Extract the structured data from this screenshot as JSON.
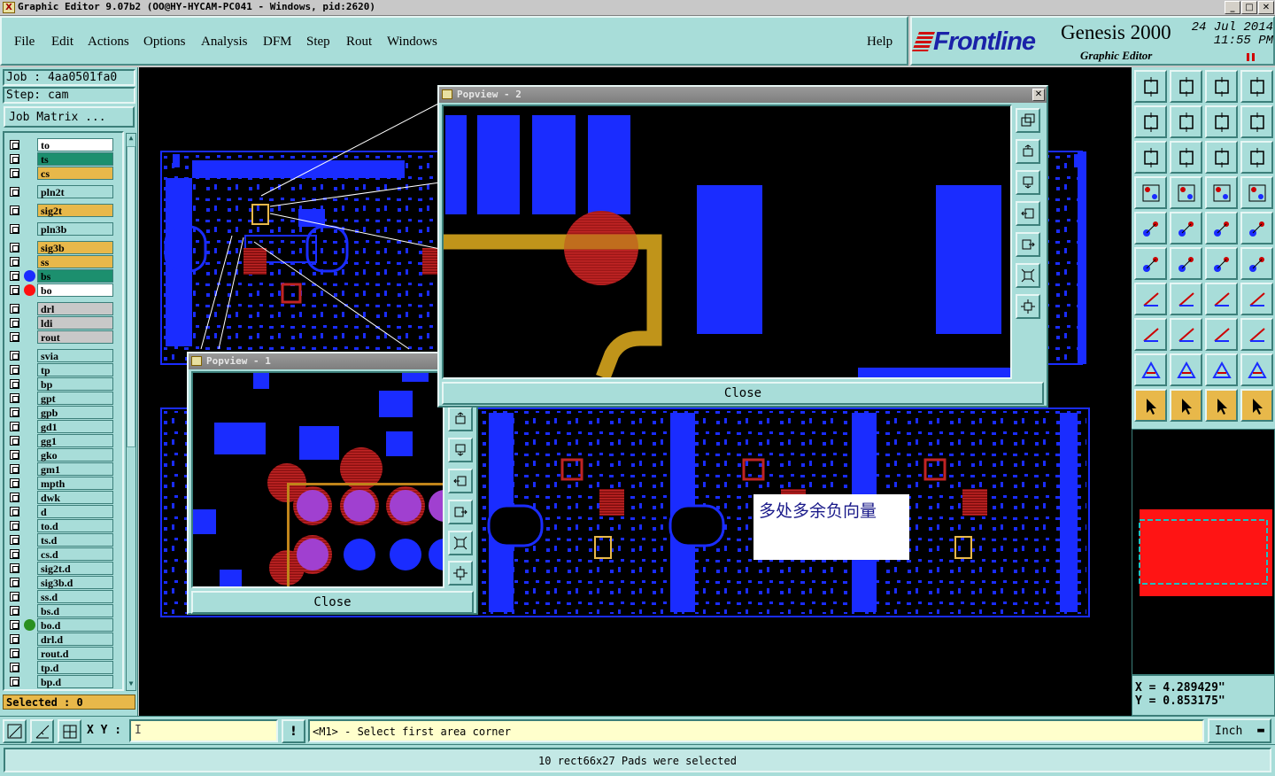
{
  "window": {
    "title": "Graphic Editor 9.07b2  (OO@HY-HYCAM-PC041 - Windows, pid:2620)",
    "min": "_",
    "max": "□",
    "close": "✕"
  },
  "menu": [
    "File",
    "Edit",
    "Actions",
    "Options",
    "Analysis",
    "DFM",
    "Step",
    "Rout",
    "Windows"
  ],
  "help": "Help",
  "brand": {
    "logo": "Frontline",
    "product": "Genesis 2000",
    "subtitle": "Graphic Editor",
    "date": "24 Jul 2014",
    "time": "11:55 PM"
  },
  "job": {
    "job": "Job : 4aa0501fa0",
    "step": "Step: cam",
    "matrix": "Job Matrix ..."
  },
  "layers": [
    {
      "name": "to",
      "bg": "#ffffff",
      "dot": ""
    },
    {
      "name": "ts",
      "bg": "#1c8f6e",
      "dot": ""
    },
    {
      "name": "cs",
      "bg": "#e8b84a",
      "dot": ""
    },
    {
      "name": "pln2t",
      "bg": "#a8ddd9",
      "dot": ""
    },
    {
      "name": "sig2t",
      "bg": "#e8b84a",
      "dot": ""
    },
    {
      "name": "pln3b",
      "bg": "#a8ddd9",
      "dot": ""
    },
    {
      "name": "sig3b",
      "bg": "#e8b84a",
      "dot": ""
    },
    {
      "name": "ss",
      "bg": "#e8b84a",
      "dot": ""
    },
    {
      "name": "bs",
      "bg": "#1c8f6e",
      "dot": "#1a2cff"
    },
    {
      "name": "bo",
      "bg": "#ffffff",
      "dot": "#ff1010"
    },
    {
      "name": "drl",
      "bg": "#c8c8c8",
      "dot": ""
    },
    {
      "name": "ldi",
      "bg": "#c8c8c8",
      "dot": ""
    },
    {
      "name": "rout",
      "bg": "#c8c8c8",
      "dot": ""
    },
    {
      "name": "svia",
      "bg": "#a8ddd9",
      "dot": ""
    },
    {
      "name": "tp",
      "bg": "#a8ddd9",
      "dot": ""
    },
    {
      "name": "bp",
      "bg": "#a8ddd9",
      "dot": ""
    },
    {
      "name": "gpt",
      "bg": "#a8ddd9",
      "dot": ""
    },
    {
      "name": "gpb",
      "bg": "#a8ddd9",
      "dot": ""
    },
    {
      "name": "gd1",
      "bg": "#a8ddd9",
      "dot": ""
    },
    {
      "name": "gg1",
      "bg": "#a8ddd9",
      "dot": ""
    },
    {
      "name": "gko",
      "bg": "#a8ddd9",
      "dot": ""
    },
    {
      "name": "gm1",
      "bg": "#a8ddd9",
      "dot": ""
    },
    {
      "name": "mpth",
      "bg": "#a8ddd9",
      "dot": ""
    },
    {
      "name": "dwk",
      "bg": "#a8ddd9",
      "dot": ""
    },
    {
      "name": "d",
      "bg": "#a8ddd9",
      "dot": ""
    },
    {
      "name": "to.d",
      "bg": "#a8ddd9",
      "dot": ""
    },
    {
      "name": "ts.d",
      "bg": "#a8ddd9",
      "dot": ""
    },
    {
      "name": "cs.d",
      "bg": "#a8ddd9",
      "dot": ""
    },
    {
      "name": "sig2t.d",
      "bg": "#a8ddd9",
      "dot": ""
    },
    {
      "name": "sig3b.d",
      "bg": "#a8ddd9",
      "dot": ""
    },
    {
      "name": "ss.d",
      "bg": "#a8ddd9",
      "dot": ""
    },
    {
      "name": "bs.d",
      "bg": "#a8ddd9",
      "dot": ""
    },
    {
      "name": "bo.d",
      "bg": "#a8ddd9",
      "dot": "#2a9020"
    },
    {
      "name": "drl.d",
      "bg": "#a8ddd9",
      "dot": ""
    },
    {
      "name": "rout.d",
      "bg": "#a8ddd9",
      "dot": ""
    },
    {
      "name": "tp.d",
      "bg": "#a8ddd9",
      "dot": ""
    },
    {
      "name": "bp.d",
      "bg": "#a8ddd9",
      "dot": ""
    }
  ],
  "selected": "Selected : 0",
  "popview1": {
    "title": "Popview - 1",
    "close": "Close"
  },
  "popview2": {
    "title": "Popview - 2",
    "close": "Close"
  },
  "note": "多处多余负向量",
  "coords": {
    "x": "X = 4.289429\"",
    "y": "Y = 0.853175\""
  },
  "xy_label": "X Y :",
  "prompt": "<M1> - Select first area corner",
  "unit": "Inch",
  "status": "10 rect66x27 Pads were selected"
}
